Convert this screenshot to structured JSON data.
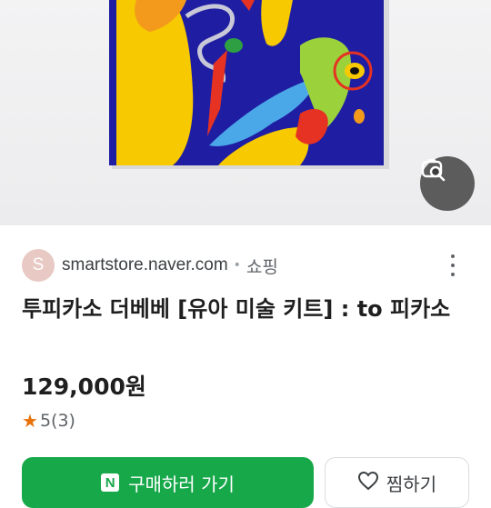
{
  "hero": {
    "image_name": "product-artwork-image",
    "lens_icon": "image-search-icon"
  },
  "result": {
    "avatar_letter": "S",
    "domain": "smartstore.naver.com",
    "separator": "•",
    "category": "쇼핑",
    "more_icon": "more-vert-icon",
    "title": "투피카소 더베베 [유아 미술 키트] : to 피카소",
    "price": "129,000원",
    "rating": {
      "star": "★",
      "score": "5",
      "count": "(3)"
    }
  },
  "actions": {
    "buy_icon_letter": "N",
    "buy_label": "구매하러 가기",
    "save_label": "찜하기"
  },
  "colors": {
    "buy_button": "#17a84a",
    "star": "#e8710a",
    "canvas_blue": "#1f1ea3"
  }
}
